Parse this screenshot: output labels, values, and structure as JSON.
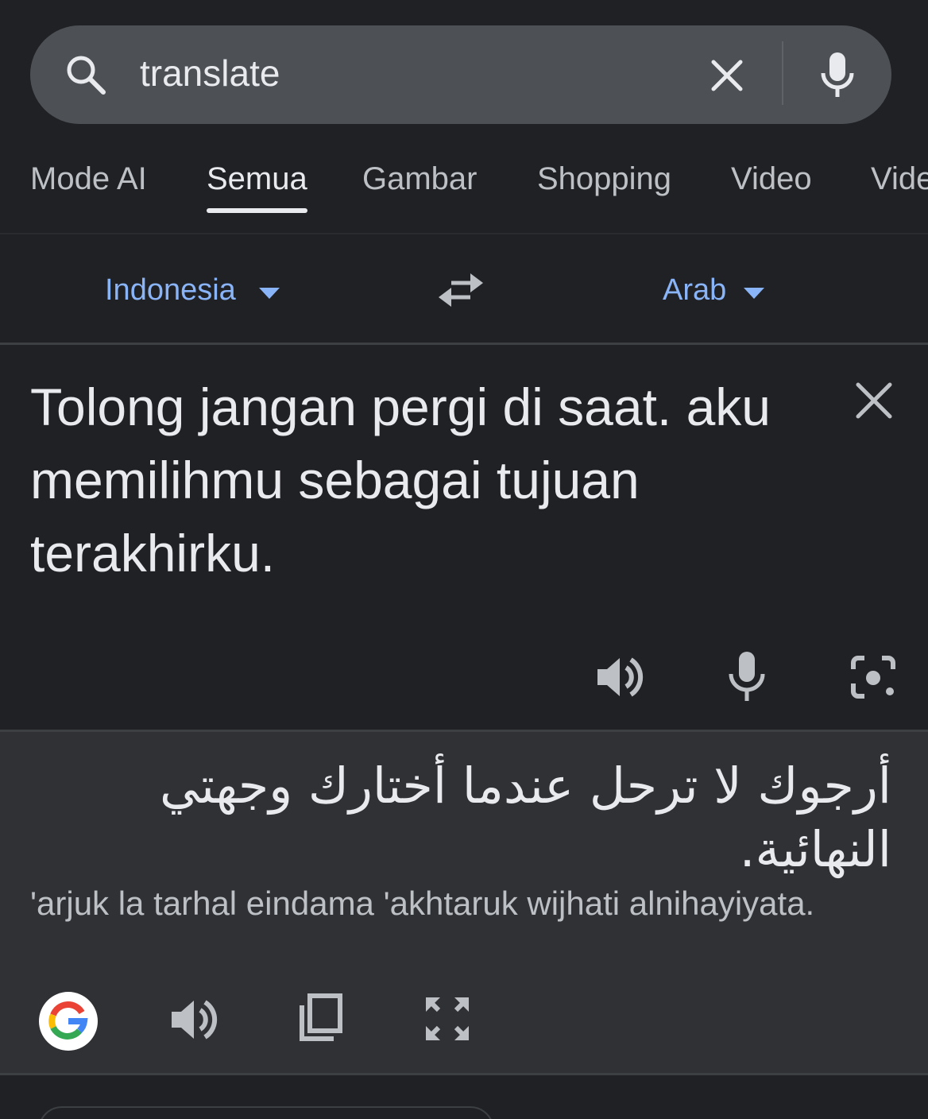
{
  "search": {
    "query": "translate"
  },
  "tabs": [
    {
      "label": "Mode AI"
    },
    {
      "label": "Semua"
    },
    {
      "label": "Gambar"
    },
    {
      "label": "Shopping"
    },
    {
      "label": "Video"
    },
    {
      "label": "Vide"
    }
  ],
  "translator": {
    "source_language": "Indonesia",
    "target_language": "Arab",
    "source_text": "Tolong jangan pergi di saat. aku memilihmu sebagai tujuan terakhirku.",
    "result_text": "أرجوك لا ترحل عندما أختارك وجهتي النهائية.",
    "transliteration": "'arjuk la tarhal eindama 'akhtaruk wijhati alnihayiyata."
  },
  "colors": {
    "background": "#202124",
    "search_bar": "#4d5156",
    "accent": "#8ab4f8",
    "result_background": "#303134"
  }
}
